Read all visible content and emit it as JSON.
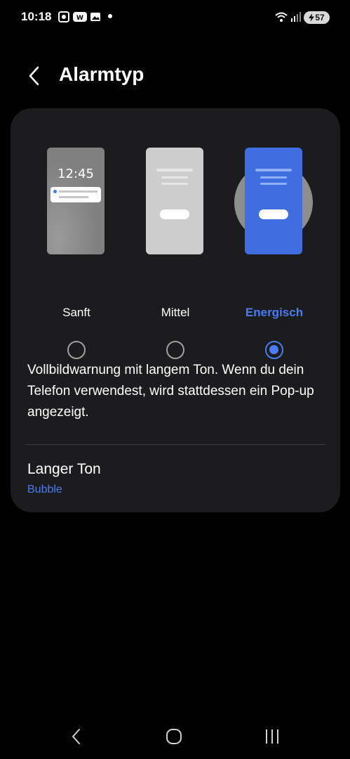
{
  "status_bar": {
    "time": "10:18",
    "battery": "57",
    "icons": [
      "whatsapp-icon",
      "webtoon-icon",
      "gallery-icon",
      "wifi-icon",
      "signal-icon",
      "battery-charging-icon"
    ]
  },
  "header": {
    "title": "Alarmtyp",
    "back_icon": "chevron-left-icon"
  },
  "alarm_types": {
    "options": [
      {
        "label": "Sanft",
        "selected": false,
        "preview_time": "12:45"
      },
      {
        "label": "Mittel",
        "selected": false
      },
      {
        "label": "Energisch",
        "selected": true
      }
    ],
    "description": "Vollbildwarnung mit langem Ton. Wenn du dein Telefon verwendest, wird stattdessen ein Pop-up angezeigt."
  },
  "long_tone": {
    "title": "Langer Ton",
    "value": "Bubble"
  },
  "colors": {
    "accent": "#4a7cf0",
    "card": "#1c1c1e",
    "background": "#000000"
  },
  "nav_bar": {
    "icons": [
      "back-nav-icon",
      "home-nav-icon",
      "recents-nav-icon"
    ]
  }
}
